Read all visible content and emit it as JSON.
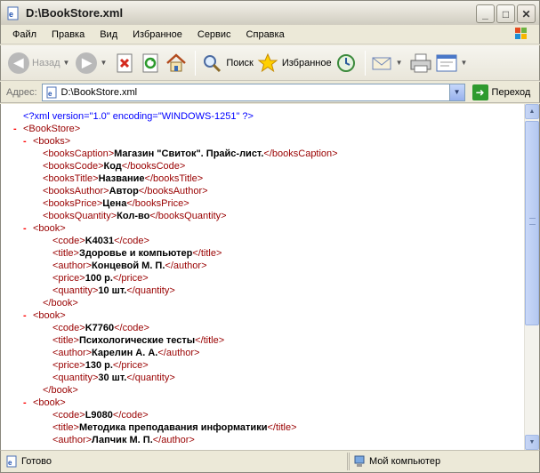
{
  "window": {
    "title": "D:\\BookStore.xml"
  },
  "menu": [
    "Файл",
    "Правка",
    "Вид",
    "Избранное",
    "Сервис",
    "Справка"
  ],
  "toolbar": {
    "back_label": "Назад",
    "search_label": "Поиск",
    "favorites_label": "Избранное"
  },
  "address": {
    "label": "Адрес:",
    "value": "D:\\BookStore.xml",
    "go_label": "Переход"
  },
  "xml_lines": [
    {
      "indent": 0,
      "minus": false,
      "pi": "<?xml version=\"1.0\" encoding=\"WINDOWS-1251\" ?>"
    },
    {
      "indent": 0,
      "minus": true,
      "open": "<BookStore>"
    },
    {
      "indent": 1,
      "minus": true,
      "open": "<books>"
    },
    {
      "indent": 2,
      "open": "<booksCaption>",
      "text": "Магазин \"Свиток\". Прайс-лист.",
      "close": "</booksCaption>"
    },
    {
      "indent": 2,
      "open": "<booksCode>",
      "text": "Код",
      "close": "</booksCode>"
    },
    {
      "indent": 2,
      "open": "<booksTitle>",
      "text": "Название",
      "close": "</booksTitle>"
    },
    {
      "indent": 2,
      "open": "<booksAuthor>",
      "text": "Автор",
      "close": "</booksAuthor>"
    },
    {
      "indent": 2,
      "open": "<booksPrice>",
      "text": "Цена",
      "close": "</booksPrice>"
    },
    {
      "indent": 2,
      "open": "<booksQuantity>",
      "text": "Кол-во",
      "close": "</booksQuantity>"
    },
    {
      "indent": 1,
      "minus": true,
      "open": "<book>"
    },
    {
      "indent": 3,
      "open": "<code>",
      "text": "K4031",
      "close": "</code>"
    },
    {
      "indent": 3,
      "open": "<title>",
      "text": "Здоровье и компьютер",
      "close": "</title>"
    },
    {
      "indent": 3,
      "open": "<author>",
      "text": "Концевой М. П.",
      "close": "</author>"
    },
    {
      "indent": 3,
      "open": "<price>",
      "text": "100 р.",
      "close": "</price>"
    },
    {
      "indent": 3,
      "open": "<quantity>",
      "text": "10 шт.",
      "close": "</quantity>"
    },
    {
      "indent": 2,
      "open": "</book>"
    },
    {
      "indent": 1,
      "minus": true,
      "open": "<book>"
    },
    {
      "indent": 3,
      "open": "<code>",
      "text": "K7760",
      "close": "</code>"
    },
    {
      "indent": 3,
      "open": "<title>",
      "text": "Психологические тесты",
      "close": "</title>"
    },
    {
      "indent": 3,
      "open": "<author>",
      "text": "Карелин А. А.",
      "close": "</author>"
    },
    {
      "indent": 3,
      "open": "<price>",
      "text": "130 р.",
      "close": "</price>"
    },
    {
      "indent": 3,
      "open": "<quantity>",
      "text": "30 шт.",
      "close": "</quantity>"
    },
    {
      "indent": 2,
      "open": "</book>"
    },
    {
      "indent": 1,
      "minus": true,
      "open": "<book>"
    },
    {
      "indent": 3,
      "open": "<code>",
      "text": "L9080",
      "close": "</code>"
    },
    {
      "indent": 3,
      "open": "<title>",
      "text": "Методика преподавания информатики",
      "close": "</title>"
    },
    {
      "indent": 3,
      "open": "<author>",
      "text": "Лапчик М. П.",
      "close": "</author>"
    }
  ],
  "status": {
    "left": "Готово",
    "right": "Мой компьютер"
  }
}
